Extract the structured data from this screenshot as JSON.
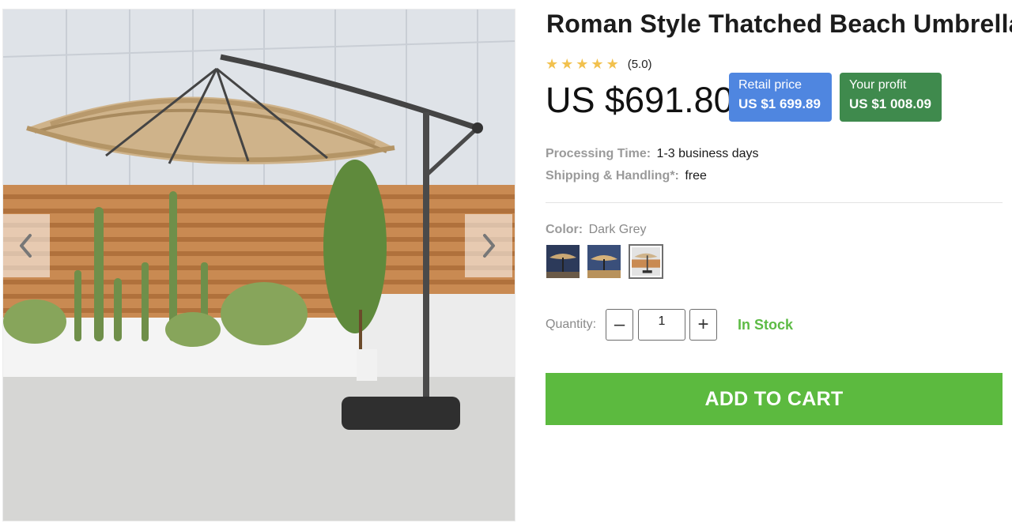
{
  "product": {
    "title": "Roman Style Thatched Beach Umbrella",
    "rating": "(5.0)",
    "stars": 5,
    "price": "US $691.80"
  },
  "retail": {
    "label": "Retail price",
    "value": "US $1 699.89",
    "color": "#4f86e0"
  },
  "profit": {
    "label": "Your profit",
    "value": "US $1 008.09",
    "color": "#3f8a4d"
  },
  "processing": {
    "label": "Processing Time:",
    "value": "1-3 business days"
  },
  "shipping": {
    "label": "Shipping & Handling*:",
    "value": "free"
  },
  "color": {
    "label": "Color:",
    "value": "Dark Grey",
    "swatches": [
      "night-scene",
      "evening-scene",
      "dark-grey"
    ],
    "selected_index": 2
  },
  "quantity": {
    "label": "Quantity:",
    "value": "1",
    "minus": "–",
    "plus": "+"
  },
  "stock": {
    "text": "In Stock",
    "color": "#5dbb45"
  },
  "cart": {
    "label": "ADD TO CART",
    "color": "#5cba3f"
  },
  "gallery": {
    "prev_icon": "chevron-left-icon",
    "next_icon": "chevron-right-icon"
  }
}
